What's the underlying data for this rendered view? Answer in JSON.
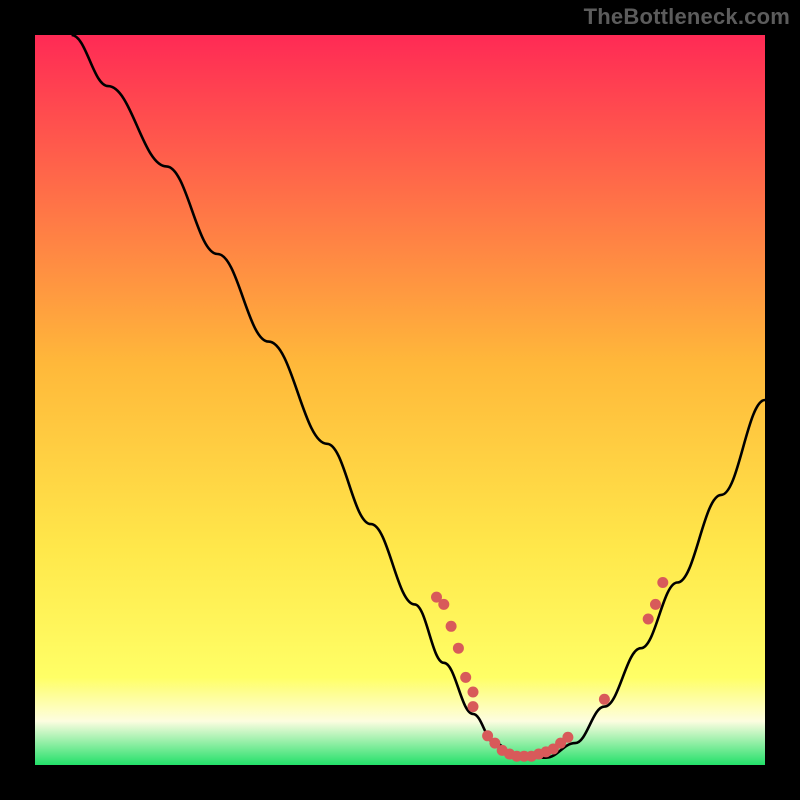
{
  "watermark": "TheBottleneck.com",
  "colors": {
    "background": "#000000",
    "gradient_top": "#ff2a55",
    "gradient_mid": "#ffd633",
    "gradient_low_yellow": "#ffff66",
    "gradient_pale": "#fdfde0",
    "gradient_bottom": "#23e069",
    "curve": "#000000",
    "dot": "#d85a5a"
  },
  "chart_data": {
    "type": "line",
    "title": "",
    "xlabel": "",
    "ylabel": "",
    "xlim": [
      0,
      100
    ],
    "ylim": [
      0,
      100
    ],
    "bottleneck_min_x": 66,
    "curve": [
      {
        "x": 5,
        "y": 100
      },
      {
        "x": 10,
        "y": 93
      },
      {
        "x": 18,
        "y": 82
      },
      {
        "x": 25,
        "y": 70
      },
      {
        "x": 32,
        "y": 58
      },
      {
        "x": 40,
        "y": 44
      },
      {
        "x": 46,
        "y": 33
      },
      {
        "x": 52,
        "y": 22
      },
      {
        "x": 56,
        "y": 14
      },
      {
        "x": 60,
        "y": 7
      },
      {
        "x": 63,
        "y": 3
      },
      {
        "x": 66,
        "y": 1
      },
      {
        "x": 70,
        "y": 1
      },
      {
        "x": 74,
        "y": 3
      },
      {
        "x": 78,
        "y": 8
      },
      {
        "x": 83,
        "y": 16
      },
      {
        "x": 88,
        "y": 25
      },
      {
        "x": 94,
        "y": 37
      },
      {
        "x": 100,
        "y": 50
      }
    ],
    "dots": [
      {
        "x": 56,
        "y": 22
      },
      {
        "x": 55,
        "y": 23
      },
      {
        "x": 57,
        "y": 19
      },
      {
        "x": 58,
        "y": 16
      },
      {
        "x": 59,
        "y": 12
      },
      {
        "x": 60,
        "y": 10
      },
      {
        "x": 60,
        "y": 8
      },
      {
        "x": 62,
        "y": 4
      },
      {
        "x": 63,
        "y": 3
      },
      {
        "x": 64,
        "y": 2
      },
      {
        "x": 65,
        "y": 1.5
      },
      {
        "x": 66,
        "y": 1.2
      },
      {
        "x": 67,
        "y": 1.2
      },
      {
        "x": 68,
        "y": 1.2
      },
      {
        "x": 69,
        "y": 1.5
      },
      {
        "x": 70,
        "y": 1.8
      },
      {
        "x": 71,
        "y": 2.2
      },
      {
        "x": 72,
        "y": 3
      },
      {
        "x": 73,
        "y": 3.8
      },
      {
        "x": 78,
        "y": 9
      },
      {
        "x": 84,
        "y": 20
      },
      {
        "x": 85,
        "y": 22
      },
      {
        "x": 86,
        "y": 25
      }
    ]
  }
}
